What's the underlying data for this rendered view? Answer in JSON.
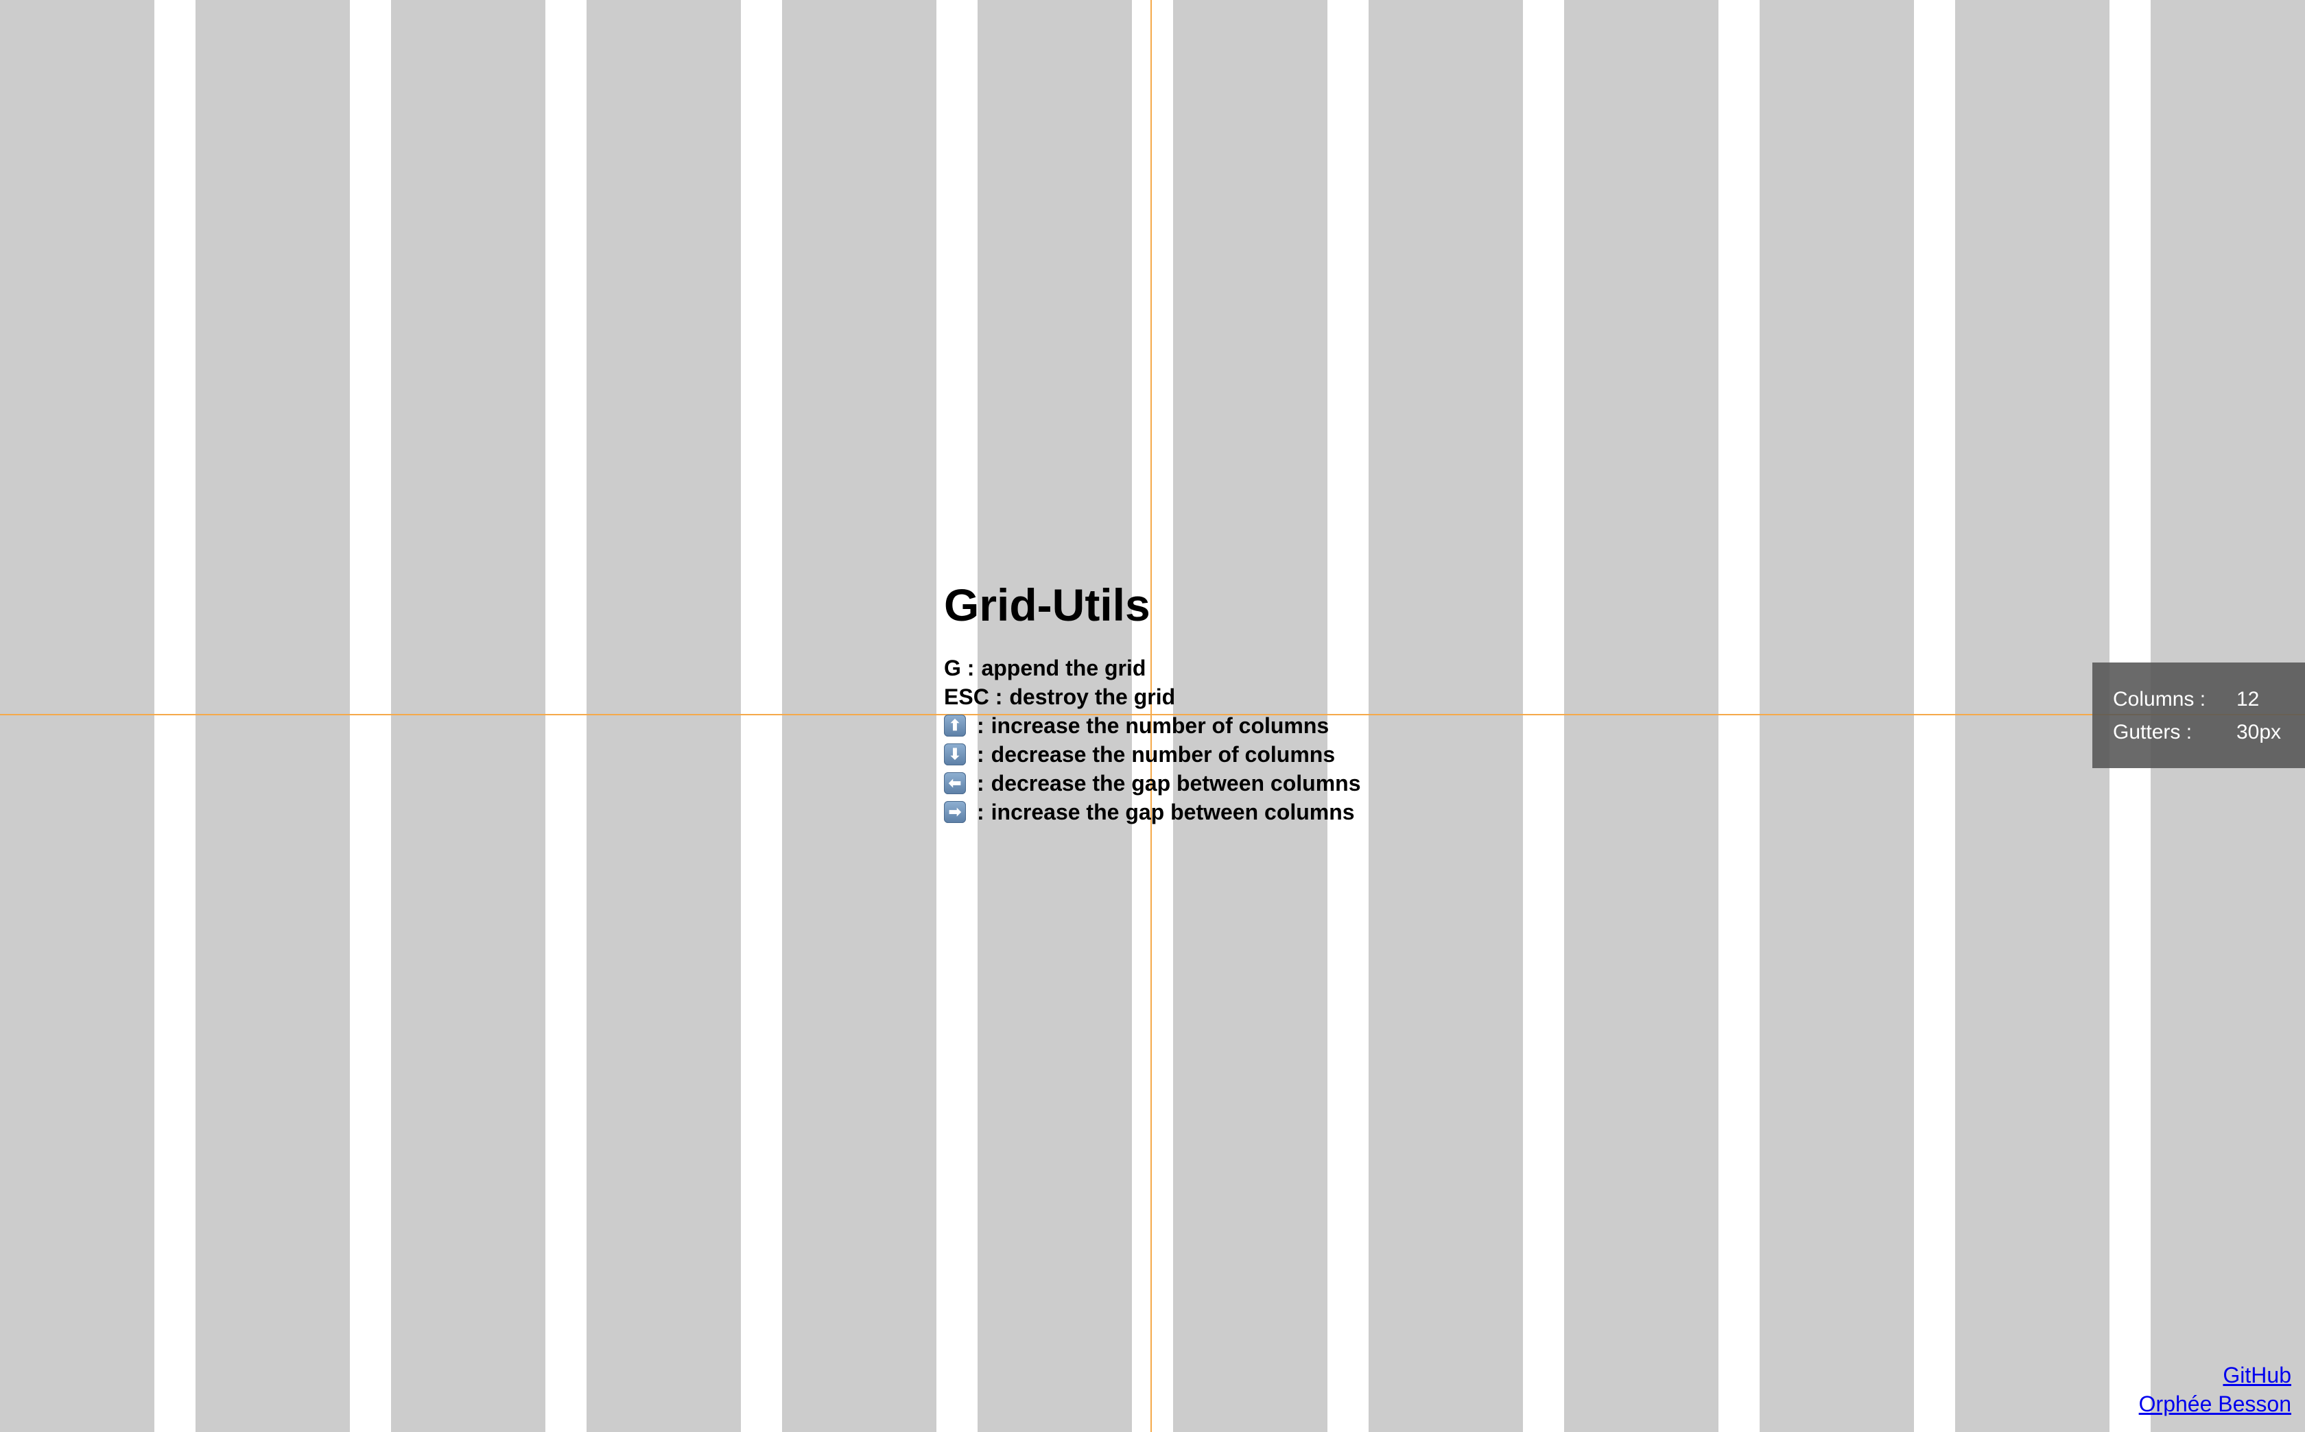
{
  "app": {
    "title": "Grid-Utils"
  },
  "shortcuts": [
    {
      "key": "G",
      "icon": null,
      "text": "append the grid"
    },
    {
      "key": "ESC",
      "icon": null,
      "text": "destroy the grid"
    },
    {
      "key": null,
      "icon": "arrow-up-key-icon",
      "glyph": "⬆",
      "text": "increase the number of columns"
    },
    {
      "key": null,
      "icon": "arrow-down-key-icon",
      "glyph": "⬇",
      "text": "decrease the number of columns"
    },
    {
      "key": null,
      "icon": "arrow-left-key-icon",
      "glyph": "⬅",
      "text": "decrease the gap between columns"
    },
    {
      "key": null,
      "icon": "arrow-right-key-icon",
      "glyph": "➡",
      "text": "increase the gap between columns"
    }
  ],
  "grid_info": {
    "columns_label": "Columns :",
    "columns_value": "12",
    "gutters_label": "Gutters :",
    "gutters_value": "30px"
  },
  "grid": {
    "column_count": 12,
    "column_color": "#cccccc",
    "crosshair_color": "#f5a94a"
  },
  "footer": {
    "github_label": "GitHub",
    "author_label": "Orphée Besson"
  }
}
